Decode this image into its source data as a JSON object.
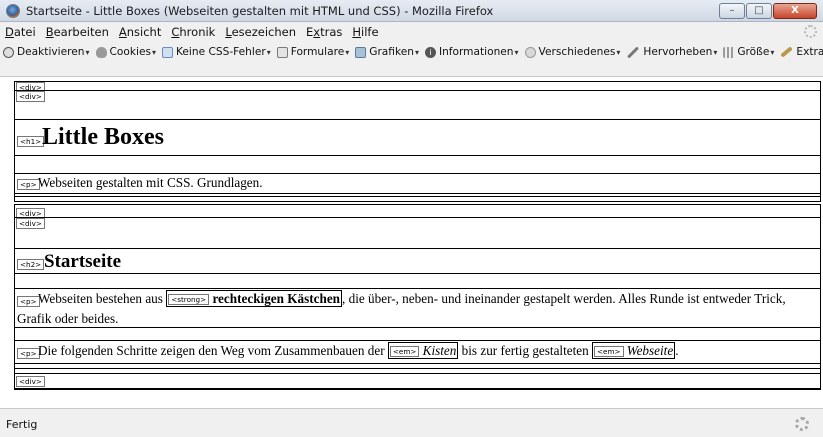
{
  "window": {
    "title": "Startseite - Little Boxes (Webseiten gestalten mit HTML und CSS) - Mozilla Firefox",
    "buttons": {
      "minimize": "–",
      "maximize": "□",
      "close": "X"
    }
  },
  "menubar": {
    "items": [
      {
        "first": "D",
        "rest": "atei"
      },
      {
        "first": "B",
        "rest": "earbeiten"
      },
      {
        "first": "A",
        "rest": "nsicht"
      },
      {
        "first": "C",
        "rest": "hronik"
      },
      {
        "first": "L",
        "rest": "esezeichen"
      },
      {
        "first": "E",
        "pre": "",
        "label_pre": "E",
        "rest": "xtras",
        "underline_index": 1
      },
      {
        "first": "H",
        "rest": "ilfe"
      }
    ]
  },
  "webdev_toolbar": {
    "deaktivieren": "Deaktivieren",
    "cookies": "Cookies",
    "keine_css_fehler": "Keine CSS-Fehler",
    "formulare": "Formulare",
    "grafiken": "Grafiken",
    "informationen": "Informationen",
    "verschiedenes": "Verschiedenes",
    "hervorheben": "Hervorheben",
    "groesse": "Größe",
    "extras": "Extras",
    "dropdown": "▾"
  },
  "page": {
    "tags": {
      "div": "<div>",
      "h1": "<h1>",
      "h2": "<h2>",
      "p": "<p>",
      "strong": "<strong>",
      "em": "<em>"
    },
    "h1": "Little Boxes",
    "subtitle": "Webseiten gestalten mit CSS. Grundlagen.",
    "h2": "Startseite",
    "para1_before": "Webseiten bestehen aus",
    "para1_strong": "rechteckigen Kästchen",
    "para1_after": ", die über-, neben- und ineinander gestapelt werden. Alles Runde ist entweder Trick,",
    "para1_line2": "Grafik oder beides.",
    "para2_before": "Die folgenden Schritte zeigen den Weg vom Zusammenbauen der",
    "para2_em1": "Kisten",
    "para2_middle": "bis zur fertig gestalteten",
    "para2_em2": "Webseite",
    "para2_end": "."
  },
  "status": {
    "text": "Fertig"
  }
}
